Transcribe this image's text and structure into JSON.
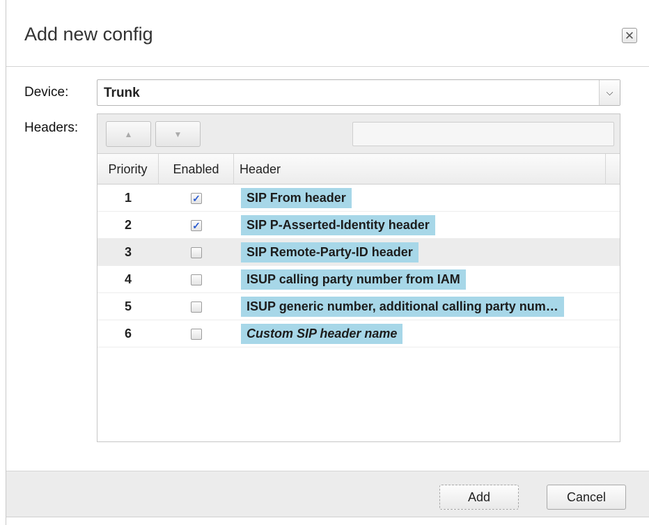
{
  "dialog": {
    "title": "Add new config",
    "close_icon": "close-icon"
  },
  "form": {
    "device_label": "Device:",
    "device_value": "Trunk",
    "headers_label": "Headers:"
  },
  "grid": {
    "toolbar": {
      "move_up_icon": "triangle-up-icon",
      "move_down_icon": "triangle-down-icon",
      "search_value": ""
    },
    "columns": [
      "Priority",
      "Enabled",
      "Header"
    ],
    "rows": [
      {
        "priority": "1",
        "enabled": true,
        "header": "SIP From header",
        "italic": false,
        "selected": false
      },
      {
        "priority": "2",
        "enabled": true,
        "header": "SIP P-Asserted-Identity header",
        "italic": false,
        "selected": false
      },
      {
        "priority": "3",
        "enabled": false,
        "header": "SIP Remote-Party-ID header",
        "italic": false,
        "selected": true
      },
      {
        "priority": "4",
        "enabled": false,
        "header": "ISUP calling party number from IAM",
        "italic": false,
        "selected": false
      },
      {
        "priority": "5",
        "enabled": false,
        "header": "ISUP generic number, additional calling party num…",
        "italic": false,
        "selected": false
      },
      {
        "priority": "6",
        "enabled": false,
        "header": "Custom SIP header name",
        "italic": true,
        "selected": false
      }
    ]
  },
  "footer": {
    "add_label": "Add",
    "cancel_label": "Cancel"
  },
  "colors": {
    "header_highlight": "#a7d7e8",
    "checkmark": "#2a5bd0",
    "footer_bg": "#ececec"
  }
}
